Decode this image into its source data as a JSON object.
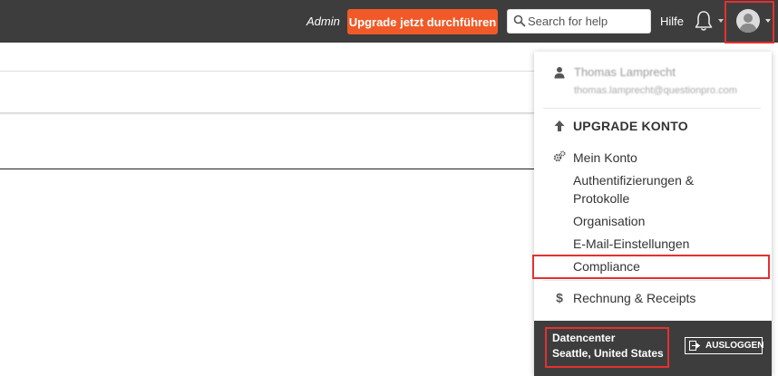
{
  "topbar": {
    "admin_label": "Admin",
    "upgrade_label": "Upgrade jetzt durchführen",
    "search_placeholder": "Search for help",
    "help_label": "Hilfe",
    "colors": {
      "bar": "#3d3d3d",
      "upgrade_button": "#f05a28",
      "highlight": "#e53030"
    },
    "icons": [
      "search-icon",
      "bell-icon",
      "avatar-icon"
    ]
  },
  "user_menu": {
    "user_name": "Thomas Lamprecht",
    "user_email": "thomas.lamprecht@questionpro.com",
    "upgrade_account": "UPGRADE KONTO",
    "my_account": "Mein Konto",
    "account_items": [
      {
        "label": "Authentifizierungen &"
      },
      {
        "label": "Protokolle"
      },
      {
        "label": "Organisation"
      },
      {
        "label": "E-Mail-Einstellungen"
      },
      {
        "label": "Compliance"
      }
    ],
    "billing": "Rechnung & Receipts",
    "icons": [
      "user-icon",
      "arrow-up-icon",
      "gears-icon",
      "dollar-icon"
    ]
  },
  "footer": {
    "datacenter_label": "Datencenter",
    "datacenter_value": "Seattle, United States",
    "logout_label": "AUSLOGGEN",
    "icons": [
      "logout-icon"
    ]
  }
}
